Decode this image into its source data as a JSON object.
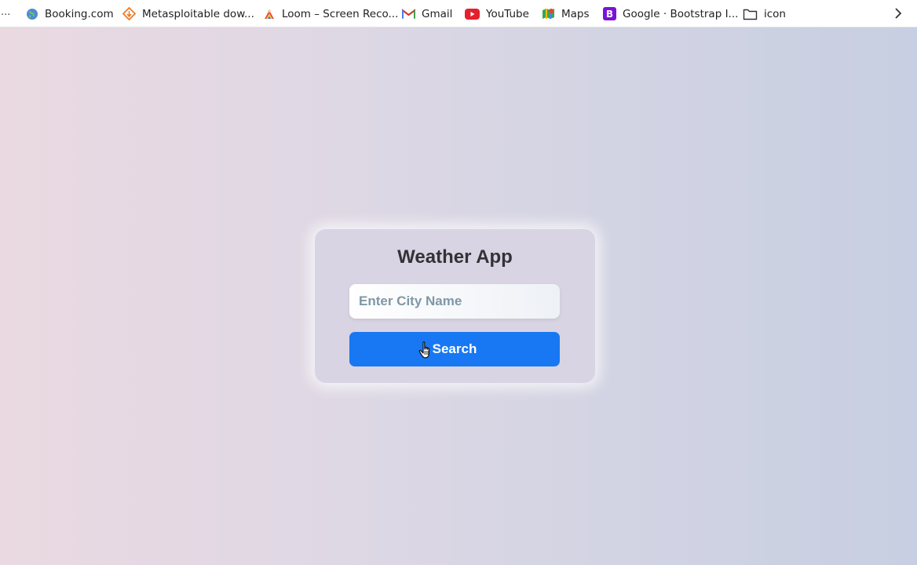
{
  "bookmarks": {
    "overflow_marker": "...",
    "items": [
      {
        "label": "Booking.com",
        "icon": "globe-icon"
      },
      {
        "label": "Metasploitable dow...",
        "icon": "sourceforge-icon"
      },
      {
        "label": "Loom – Screen Reco...",
        "icon": "loom-icon"
      },
      {
        "label": "Gmail",
        "icon": "gmail-icon"
      },
      {
        "label": "YouTube",
        "icon": "youtube-icon"
      },
      {
        "label": "Maps",
        "icon": "maps-icon"
      },
      {
        "label": "Google · Bootstrap I...",
        "icon": "bootstrap-icon"
      },
      {
        "label": "icon",
        "icon": "folder-icon"
      }
    ],
    "more_icon": "chevron-right-icon"
  },
  "app": {
    "title": "Weather App",
    "city_input": {
      "placeholder": "Enter City Name",
      "value": ""
    },
    "search_label": "Search"
  },
  "colors": {
    "primary_button": "#1878f3",
    "card_background": "#d8d4e3",
    "title_text": "#333236",
    "placeholder_text": "#7f97a6"
  }
}
